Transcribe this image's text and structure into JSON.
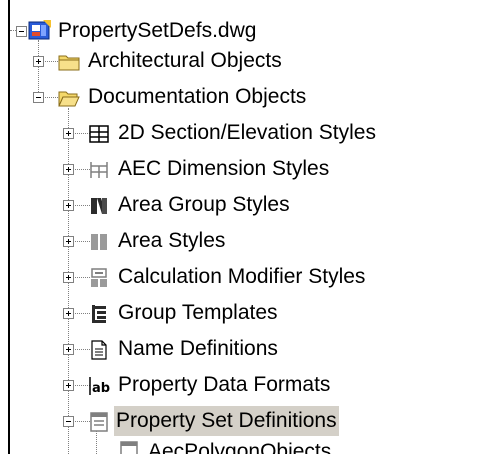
{
  "tree": {
    "root": {
      "label": "PropertySetDefs.dwg",
      "icon": "drawing-file-icon",
      "expanded": true
    },
    "categories": [
      {
        "label": "Architectural Objects",
        "icon": "folder-icon",
        "expanded": false
      },
      {
        "label": "Documentation Objects",
        "icon": "folder-open-icon",
        "expanded": true
      }
    ],
    "documentation_children": [
      {
        "label": "2D Section/Elevation Styles",
        "icon": "section-elevation-icon",
        "expanded": false
      },
      {
        "label": "AEC Dimension Styles",
        "icon": "dimension-style-icon",
        "expanded": false
      },
      {
        "label": "Area Group Styles",
        "icon": "area-group-icon",
        "expanded": false
      },
      {
        "label": "Area Styles",
        "icon": "area-style-icon",
        "expanded": false
      },
      {
        "label": "Calculation Modifier Styles",
        "icon": "calculation-modifier-icon",
        "expanded": false
      },
      {
        "label": "Group Templates",
        "icon": "group-template-icon",
        "expanded": false
      },
      {
        "label": "Name Definitions",
        "icon": "name-definition-icon",
        "expanded": false
      },
      {
        "label": "Property Data Formats",
        "icon": "ab-format-icon",
        "expanded": false
      },
      {
        "label": "Property Set Definitions",
        "icon": "property-set-icon",
        "expanded": true,
        "selected": true
      }
    ],
    "partial_child": {
      "label": "AecPolygonObjects",
      "icon": "property-set-item-icon"
    }
  },
  "colors": {
    "selection": "#d4d0c8",
    "folder": "#f4d86a",
    "icon_gray": "#7f7f7f",
    "root_blue": "#2a5bd7"
  }
}
